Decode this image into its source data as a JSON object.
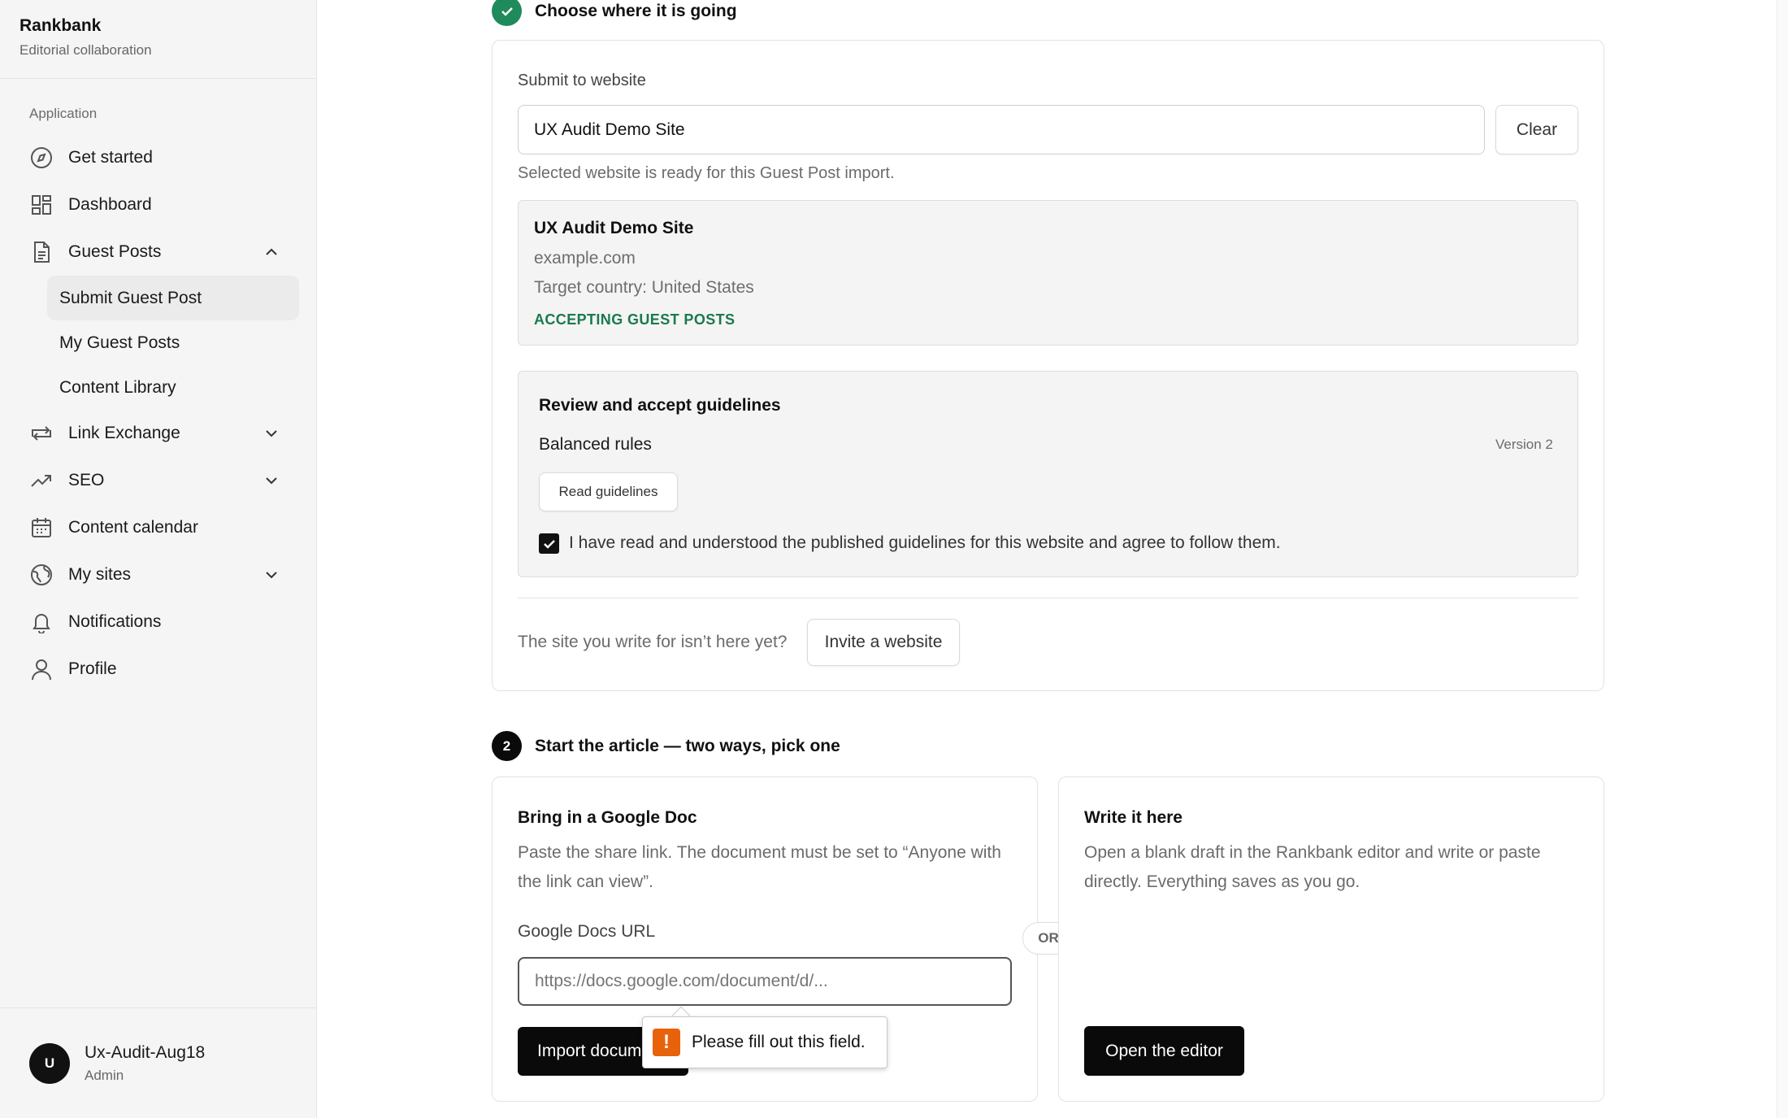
{
  "app": {
    "name": "Rankbank",
    "subtitle": "Editorial collaboration"
  },
  "sidebar": {
    "group_label": "Application",
    "items": [
      {
        "label": "Get started",
        "icon": "compass-icon"
      },
      {
        "label": "Dashboard",
        "icon": "dashboard-icon"
      },
      {
        "label": "Guest Posts",
        "icon": "document-icon",
        "expanded": true,
        "children": [
          "Submit Guest Post",
          "My Guest Posts",
          "Content Library"
        ],
        "active_child": "Submit Guest Post"
      },
      {
        "label": "Link Exchange",
        "icon": "exchange-icon"
      },
      {
        "label": "SEO",
        "icon": "trending-up-icon"
      },
      {
        "label": "Content calendar",
        "icon": "calendar-icon"
      },
      {
        "label": "My sites",
        "icon": "globe-icon"
      },
      {
        "label": "Notifications",
        "icon": "bell-icon"
      },
      {
        "label": "Profile",
        "icon": "user-icon"
      }
    ],
    "user": {
      "initial": "U",
      "name": "Ux-Audit-Aug18",
      "role": "Admin"
    }
  },
  "step1": {
    "title": "Choose where it is going",
    "website_label": "Submit to website",
    "website_value": "UX Audit Demo Site",
    "clear_label": "Clear",
    "ready_text": "Selected website is ready for this Guest Post import.",
    "site": {
      "name": "UX Audit Demo Site",
      "domain": "example.com",
      "country": "Target country: United States",
      "status": "ACCEPTING GUEST POSTS"
    },
    "guidelines": {
      "title": "Review and accept guidelines",
      "rules_name": "Balanced rules",
      "version": "Version 2",
      "read_label": "Read guidelines",
      "agree_text": "I have read and understood the published guidelines for this website and agree to follow them.",
      "agreed": true
    },
    "invite_prompt": "The site you write for isn’t here yet?",
    "invite_label": "Invite a website"
  },
  "step2": {
    "number": "2",
    "title": "Start the article — two ways, pick one",
    "google": {
      "title": "Bring in a Google Doc",
      "desc_line1": "Paste the share link. The document must be set to “Anyone with",
      "desc_line2": "the link can view”.",
      "url_label": "Google Docs URL",
      "url_placeholder": "https://docs.google.com/document/d/...",
      "import_label": "Import docum"
    },
    "or_label": "OR",
    "editor": {
      "title": "Write it here",
      "desc_line1": "Open a blank draft in the Rankbank editor and write or paste",
      "desc_line2": "directly. Everything saves as you go.",
      "open_label": "Open the editor"
    }
  },
  "validation": {
    "message": "Please fill out this field."
  },
  "colors": {
    "accent_green": "#1f8a5b",
    "status_green": "#1a7a4c",
    "dark": "#0a0a0a",
    "warning": "#e8620c"
  }
}
